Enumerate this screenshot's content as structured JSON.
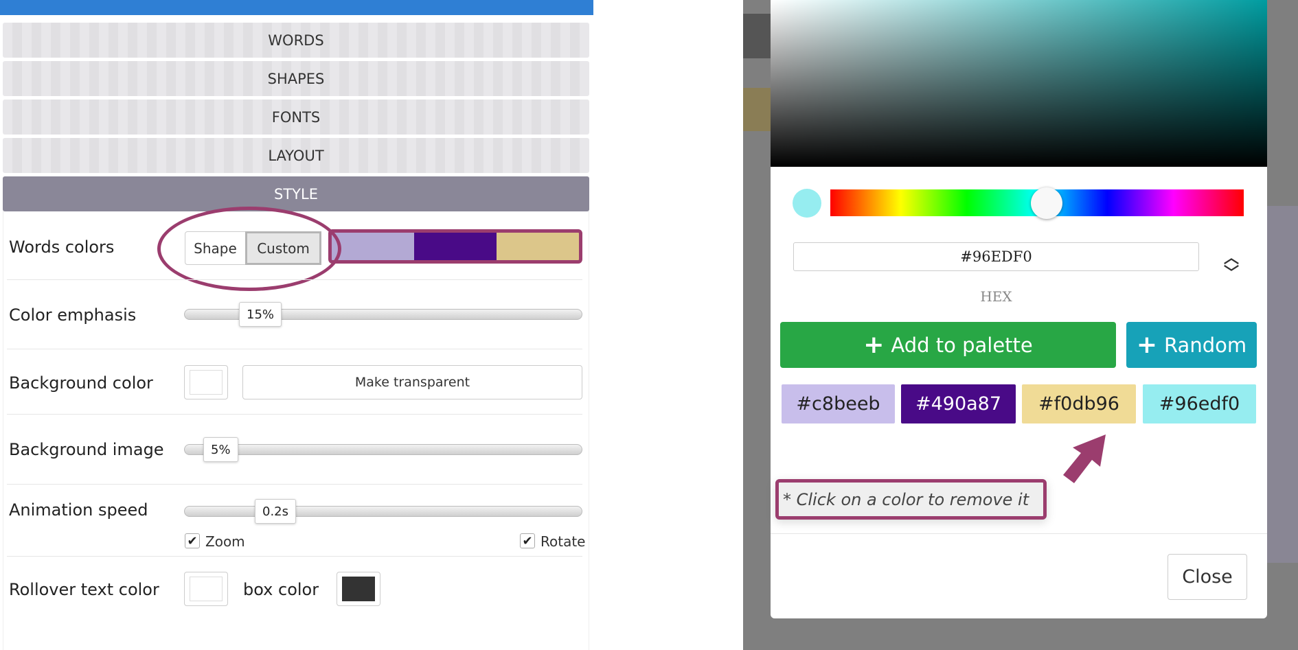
{
  "accordion": [
    {
      "label": "WORDS"
    },
    {
      "label": "SHAPES"
    },
    {
      "label": "FONTS"
    },
    {
      "label": "LAYOUT"
    },
    {
      "label": "STYLE",
      "active": true
    }
  ],
  "style": {
    "words_colors": {
      "label": "Words colors",
      "options": [
        "Shape",
        "Custom"
      ],
      "selected": "Custom",
      "palette": [
        "#b3a9d4",
        "#490a87",
        "#dcc68a"
      ]
    },
    "color_emphasis": {
      "label": "Color emphasis",
      "value": "15%",
      "fraction": 0.15
    },
    "background_color": {
      "label": "Background color",
      "button": "Make transparent",
      "color": "#ffffff"
    },
    "background_image": {
      "label": "Background image",
      "value": "5%",
      "fraction": 0.05
    },
    "animation_speed": {
      "label": "Animation speed",
      "value": "0.2s",
      "zoom_label": "Zoom",
      "zoom_checked": true,
      "rotate_label": "Rotate",
      "rotate_checked": true
    },
    "rollover": {
      "label": "Rollover text color",
      "text_color": "#ffffff",
      "box_label": "box color",
      "box_color": "#333333"
    }
  },
  "picker": {
    "current_color": "#96edf0",
    "hex_value": "#96EDF0",
    "format_label": "HEX",
    "add_label": "Add to palette",
    "random_label": "Random",
    "palette": [
      {
        "hex": "#c8beeb",
        "text": "#222"
      },
      {
        "hex": "#490a87",
        "text": "#fff"
      },
      {
        "hex": "#f0db96",
        "text": "#222"
      },
      {
        "hex": "#96edf0",
        "text": "#222"
      }
    ],
    "note": "* Click on a color to remove it",
    "close_label": "Close",
    "colors": {
      "green": "#28a745",
      "teal": "#17a2b8",
      "highlight": "#9b3d6e"
    }
  }
}
